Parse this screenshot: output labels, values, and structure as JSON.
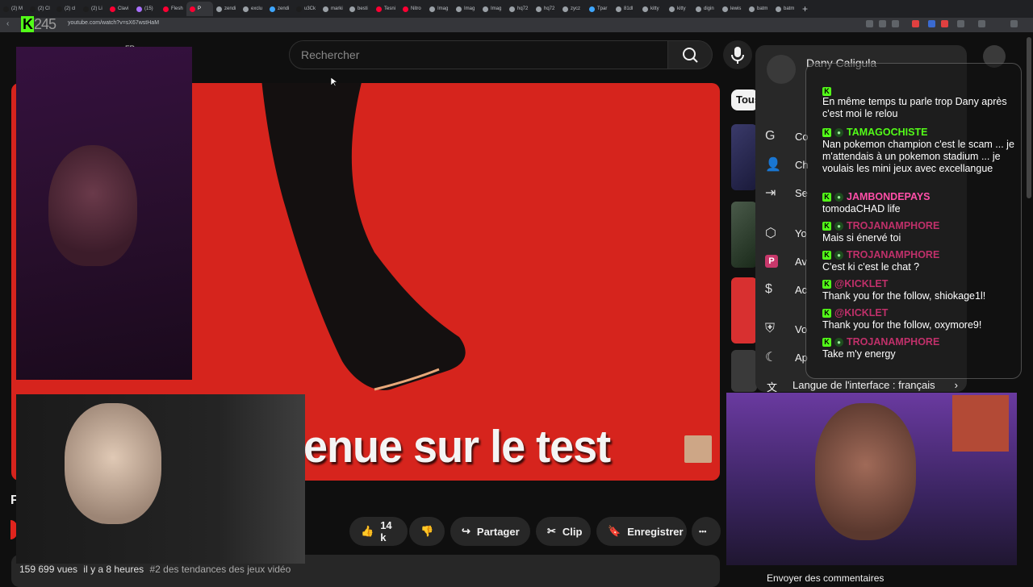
{
  "browser": {
    "tabs": [
      {
        "label": "(2) M",
        "color": "#1d1d1d"
      },
      {
        "label": "(2) Cl",
        "color": "#1d1d1d"
      },
      {
        "label": "(2) cl",
        "color": "#1d1d1d"
      },
      {
        "label": "(2) Li",
        "color": "#1d1d1d"
      },
      {
        "label": "Clavi",
        "color": "#ff0033"
      },
      {
        "label": "(15)",
        "color": "#a970ff"
      },
      {
        "label": "Flesh",
        "color": "#ff0033"
      },
      {
        "label": "P",
        "color": "#ff0033",
        "active": true
      },
      {
        "label": "zendi",
        "color": "#9aa0a6"
      },
      {
        "label": "exclu",
        "color": "#9aa0a6"
      },
      {
        "label": "zendi",
        "color": "#3ea6ff"
      },
      {
        "label": "u3Ck",
        "color": "#1d1d1d"
      },
      {
        "label": "marki",
        "color": "#9aa0a6"
      },
      {
        "label": "besti",
        "color": "#9aa0a6"
      },
      {
        "label": "Tesni",
        "color": "#ff0033"
      },
      {
        "label": "Nitro",
        "color": "#ff0033"
      },
      {
        "label": "Imag",
        "color": "#9aa0a6"
      },
      {
        "label": "Imag",
        "color": "#9aa0a6"
      },
      {
        "label": "Imag",
        "color": "#9aa0a6"
      },
      {
        "label": "hq72",
        "color": "#9aa0a6"
      },
      {
        "label": "hq72",
        "color": "#9aa0a6"
      },
      {
        "label": "zycz",
        "color": "#9aa0a6"
      },
      {
        "label": "Tpar",
        "color": "#3ea6ff"
      },
      {
        "label": "81dl",
        "color": "#9aa0a6"
      },
      {
        "label": "kitty",
        "color": "#9aa0a6"
      },
      {
        "label": "kitty",
        "color": "#9aa0a6"
      },
      {
        "label": "digin",
        "color": "#9aa0a6"
      },
      {
        "label": "lewis",
        "color": "#9aa0a6"
      },
      {
        "label": "batm",
        "color": "#9aa0a6"
      },
      {
        "label": "batm",
        "color": "#9aa0a6"
      }
    ],
    "new_tab": "+",
    "url": "youtube.com/watch?v=sX67wstHaM",
    "overlay_logo_k": "K",
    "overlay_logo_num": "245"
  },
  "youtube": {
    "search_placeholder": "Rechercher",
    "fr_label": "FR",
    "chip_all": "Tous",
    "left_fragment": "F",
    "video_caption": "enue sur le test",
    "actions": {
      "likes": "14 k",
      "share": "Partager",
      "clip": "Clip",
      "save": "Enregistrer",
      "more": "•••"
    },
    "stats": {
      "views": "159 699 vues",
      "time": "il y a 8 heures",
      "trend": "#2 des tendances des jeux vidéo"
    }
  },
  "menu": {
    "name": "Dany Caligula",
    "items": [
      {
        "icon": "G",
        "label": "Co"
      },
      {
        "icon": "👤",
        "label": "Ch"
      },
      {
        "icon": "⇥",
        "label": "Se"
      },
      {
        "icon": "⬡",
        "label": "Yo"
      },
      {
        "icon": "P",
        "label": "Av"
      },
      {
        "icon": "$",
        "label": "Ac"
      },
      {
        "icon": "⛨",
        "label": "Vo"
      },
      {
        "icon": "☾",
        "label": "Ap"
      }
    ],
    "language_label": "Langue de l'interface : français",
    "language_chevron": "›",
    "feedback": "Envoyer des commentaires"
  },
  "chat": [
    {
      "user": "",
      "user_color": "#a0356b",
      "message": "En même temps tu parle trop Dany après c'est moi le relou"
    },
    {
      "user": "TAMAGOCHISTE",
      "user_color": "#53fc18",
      "message": "Nan pokemon champion c'est le scam ... je m'attendais à un pokemon stadium ... je voulais les mini jeux avec excellangue"
    },
    {
      "user": "JAMBONDEPAYS",
      "user_color": "#ff4fa8",
      "message": "tomodaCHAD life"
    },
    {
      "user": "TROJANAMPHORE",
      "user_color": "#c0306a",
      "message": "Mais si énervé toi"
    },
    {
      "user": "TROJANAMPHORE",
      "user_color": "#c0306a",
      "message": "C'est ki c'est le chat ?"
    },
    {
      "user": "@KICKLET",
      "user_color": "#c0306a",
      "message": "Thank you for the follow, shiokage1l!"
    },
    {
      "user": "@KICKLET",
      "user_color": "#c0306a",
      "message": "Thank you for the follow, oxymore9!"
    },
    {
      "user": "TROJANAMPHORE",
      "user_color": "#c0306a",
      "message": "Take m'y energy"
    }
  ]
}
